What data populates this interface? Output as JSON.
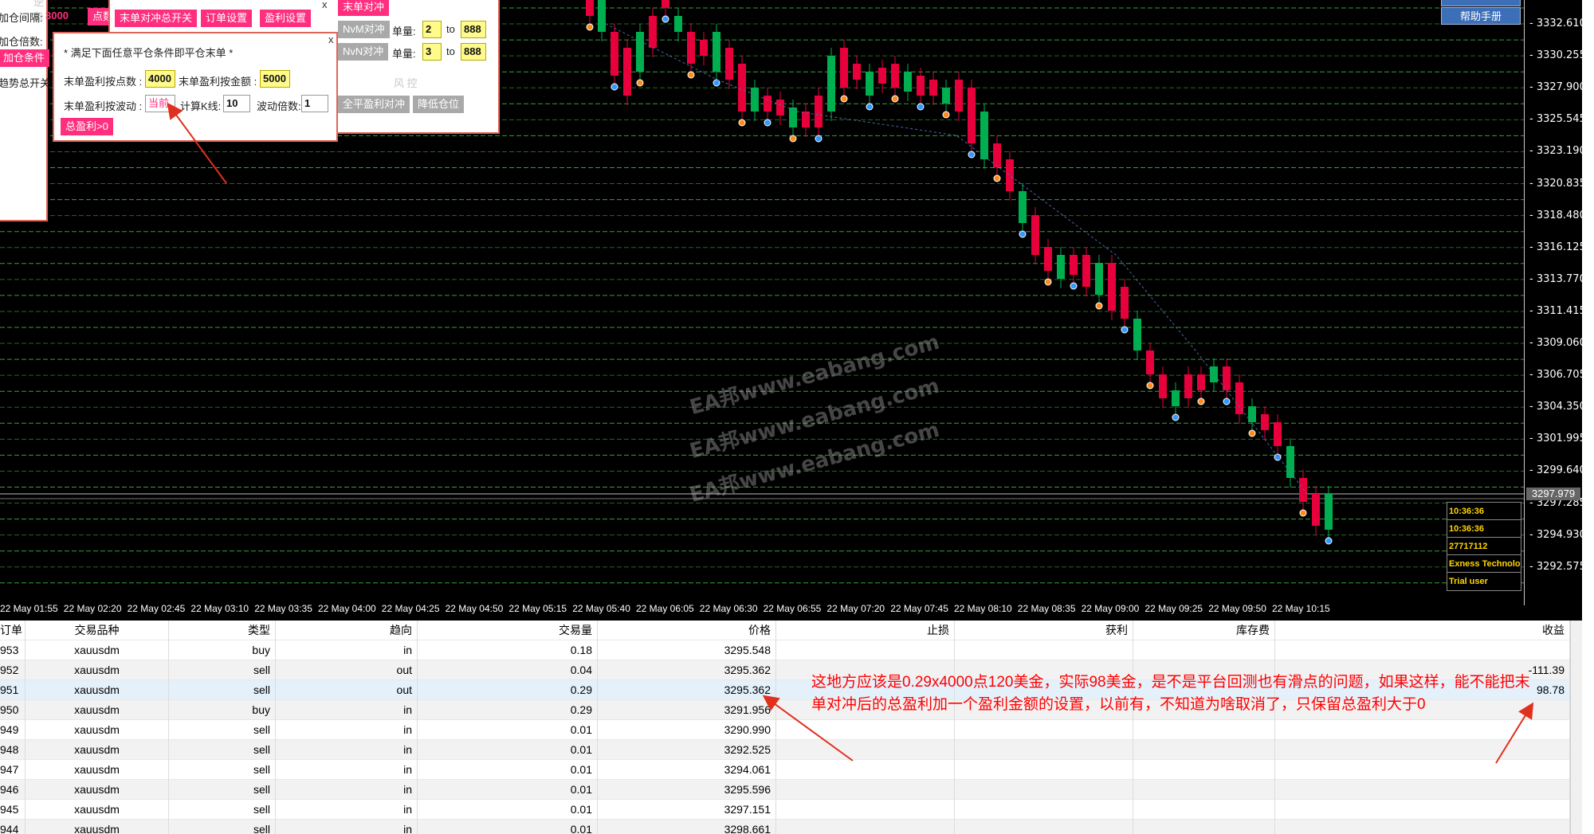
{
  "chart": {
    "price_ticks": [
      "3332.610",
      "3330.255",
      "3327.900",
      "3325.545",
      "3323.190",
      "3320.835",
      "3318.480",
      "3316.125",
      "3313.770",
      "3311.415",
      "3309.060",
      "3306.705",
      "3304.350",
      "3301.995",
      "3299.640",
      "3297.285",
      "3294.930",
      "3292.575"
    ],
    "current_price": "3297.979",
    "time_ticks": [
      "22 May 01:55",
      "22 May 02:20",
      "22 May 02:45",
      "22 May 03:10",
      "22 May 03:35",
      "22 May 04:00",
      "22 May 04:25",
      "22 May 04:50",
      "22 May 05:15",
      "22 May 05:40",
      "22 May 06:05",
      "22 May 06:30",
      "22 May 06:55",
      "22 May 07:20",
      "22 May 07:45",
      "22 May 08:10",
      "22 May 08:35",
      "22 May 09:00",
      "22 May 09:25",
      "22 May 09:50",
      "22 May 10:15"
    ],
    "watermark": "EA邦www.eabang.com",
    "info_panel": [
      "10:36:36",
      "10:36:36",
      "27717112",
      "Exness Technolo",
      "Trial user"
    ],
    "help_buttons": [
      "帮助手册"
    ],
    "colors": {
      "bull": "#00b050",
      "bear": "#e8003c",
      "grid": "#3fbf3f"
    }
  },
  "left_panel": {
    "rows": [
      {
        "label": "加仓间隔:",
        "value": "3000",
        "btn": "点数"
      },
      {
        "label": "加仓倍数:"
      },
      {
        "btn": "加仓条件"
      },
      {
        "label": "趋势总开关:"
      }
    ],
    "section_hint": "逆 势"
  },
  "order_panel": {
    "buttons": [
      "末单对冲总开关",
      "订单设置",
      "盈利设置"
    ],
    "close_label": "x",
    "hedge_btn": "末单对冲",
    "nvm_btn": "NvM对冲",
    "nvn_btn": "NvN对冲",
    "qty_label": "单量:",
    "qty1": "2",
    "qty2": "3",
    "to_label": "to",
    "to1": "888",
    "to2": "888",
    "risk_title": "风 控",
    "close_all_btn": "全平盈利对冲",
    "reduce_btn": "降低仓位"
  },
  "profit_popup": {
    "title": "* 满足下面任意平仓条件即平仓末单 *",
    "close_label": "x",
    "points_label": "末单盈利按点数 :",
    "points_value": "4000",
    "amount_label": "末单盈利按金额 :",
    "amount_value": "5000",
    "wave_label": "末单盈利按波动 :",
    "wave_btn": "当前",
    "kline_label": "计算K线:",
    "kline_value": "10",
    "mult_label": "波动倍数:",
    "mult_value": "1",
    "total_btn": "总盈利>0"
  },
  "table": {
    "headers": [
      "订单",
      "交易品种",
      "类型",
      "趋向",
      "交易量",
      "价格",
      "止损",
      "获利",
      "库存费",
      "收益"
    ],
    "rows": [
      [
        "953",
        "xauusdm",
        "buy",
        "in",
        "0.18",
        "3295.548",
        "",
        "",
        "",
        ""
      ],
      [
        "952",
        "xauusdm",
        "sell",
        "out",
        "0.04",
        "3295.362",
        "",
        "",
        "",
        "-111.39"
      ],
      [
        "951",
        "xauusdm",
        "sell",
        "out",
        "0.29",
        "3295.362",
        "",
        "",
        "",
        "98.78"
      ],
      [
        "950",
        "xauusdm",
        "buy",
        "in",
        "0.29",
        "3291.956",
        "",
        "",
        "",
        ""
      ],
      [
        "949",
        "xauusdm",
        "sell",
        "in",
        "0.01",
        "3290.990",
        "",
        "",
        "",
        ""
      ],
      [
        "948",
        "xauusdm",
        "sell",
        "in",
        "0.01",
        "3292.525",
        "",
        "",
        "",
        ""
      ],
      [
        "947",
        "xauusdm",
        "sell",
        "in",
        "0.01",
        "3294.061",
        "",
        "",
        "",
        ""
      ],
      [
        "946",
        "xauusdm",
        "sell",
        "in",
        "0.01",
        "3295.596",
        "",
        "",
        "",
        ""
      ],
      [
        "945",
        "xauusdm",
        "sell",
        "in",
        "0.01",
        "3297.151",
        "",
        "",
        "",
        ""
      ],
      [
        "944",
        "xauusdm",
        "sell",
        "in",
        "0.01",
        "3298.661",
        "",
        "",
        "",
        ""
      ]
    ]
  },
  "annotation": "这地方应该是0.29x4000点120美金，实际98美金，是不是平台回测也有滑点的问题，如果这样，能不能把末单对冲后的总盈利加一个盈利金额的设置，以前有，不知道为啥取消了，只保留总盈利大于0"
}
